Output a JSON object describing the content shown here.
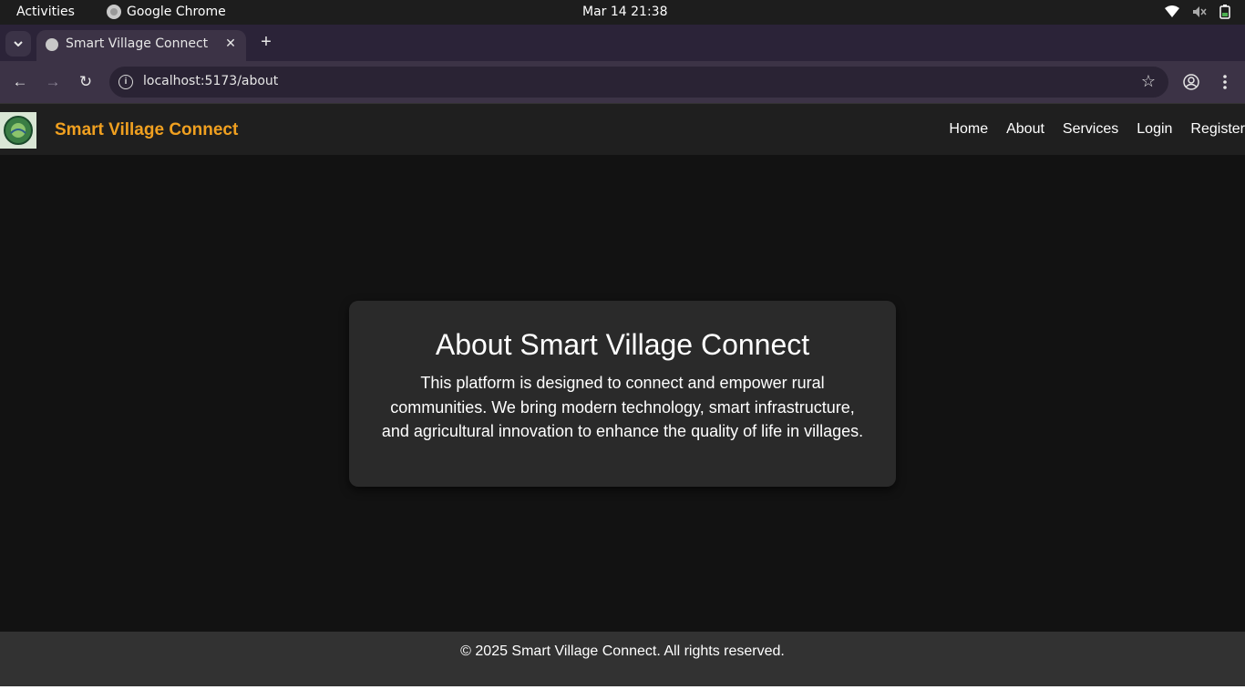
{
  "system_bar": {
    "activities": "Activities",
    "app_name": "Google Chrome",
    "clock": "Mar 14  21:38",
    "icons": [
      "wifi-icon",
      "volume-muted-icon",
      "battery-icon"
    ]
  },
  "browser": {
    "tab_title": "Smart Village Connect",
    "url": "localhost:5173/about",
    "icons": [
      "back-icon",
      "forward-icon",
      "reload-icon",
      "site-info-icon",
      "bookmark-star-icon",
      "profile-icon",
      "menu-dots-icon"
    ]
  },
  "site": {
    "brand": "Smart Village Connect",
    "nav": {
      "home": "Home",
      "about": "About",
      "services": "Services",
      "login": "Login",
      "register": "Register"
    },
    "about": {
      "heading": "About Smart Village Connect",
      "body": "This platform is designed to connect and empower rural communities. We bring modern technology, smart infrastructure, and agricultural innovation to enhance the quality of life in villages."
    },
    "footer": "© 2025 Smart Village Connect. All rights reserved."
  },
  "colors": {
    "brand_accent": "#f0a020",
    "page_bg": "#121212",
    "card_bg": "#2a2a2a",
    "footer_bg": "#323232"
  }
}
